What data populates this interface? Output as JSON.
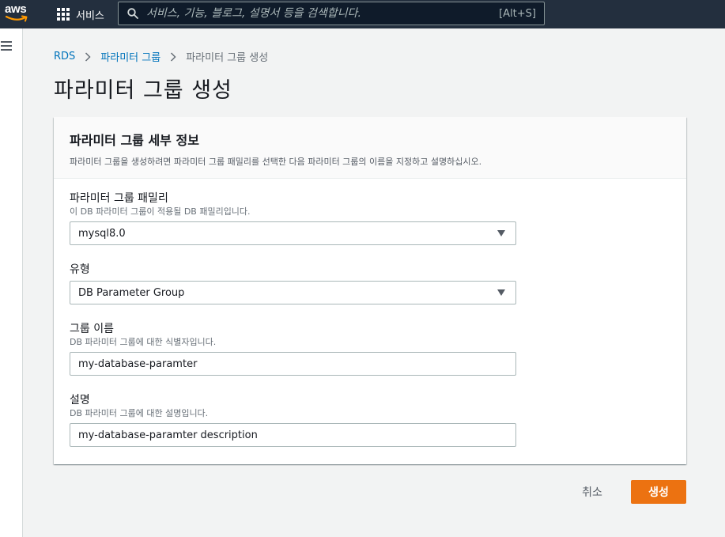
{
  "nav": {
    "logo_text": "aws",
    "services_label": "서비스",
    "search_placeholder": "서비스, 기능, 블로그, 설명서 등을 검색합니다.",
    "search_shortcut": "[Alt+S]"
  },
  "breadcrumb": {
    "items": [
      "RDS",
      "파라미터 그룹",
      "파라미터 그룹 생성"
    ]
  },
  "page_title": "파라미터 그룹 생성",
  "container": {
    "title": "파라미터 그룹 세부 정보",
    "description": "파라미터 그룹을 생성하려면 파라미터 그룹 패밀리를 선택한 다음 파라미터 그룹의 이름을 지정하고 설명하십시오."
  },
  "fields": {
    "family": {
      "label": "파라미터 그룹 패밀리",
      "description": "이 DB 파라미터 그룹이 적용될 DB 패밀리입니다.",
      "value": "mysql8.0"
    },
    "type": {
      "label": "유형",
      "value": "DB Parameter Group"
    },
    "group_name": {
      "label": "그룹 이름",
      "description": "DB 파라미터 그룹에 대한 식별자입니다.",
      "value": "my-database-paramter"
    },
    "description": {
      "label": "설명",
      "description": "DB 파라미터 그룹에 대한 설명입니다.",
      "value": "my-database-paramter description"
    }
  },
  "actions": {
    "cancel_label": "취소",
    "create_label": "생성"
  },
  "colors": {
    "topnav_bg": "#232f3e",
    "link": "#0073bb",
    "primary_button": "#ec7211",
    "logo_smile": "#ff9900"
  }
}
